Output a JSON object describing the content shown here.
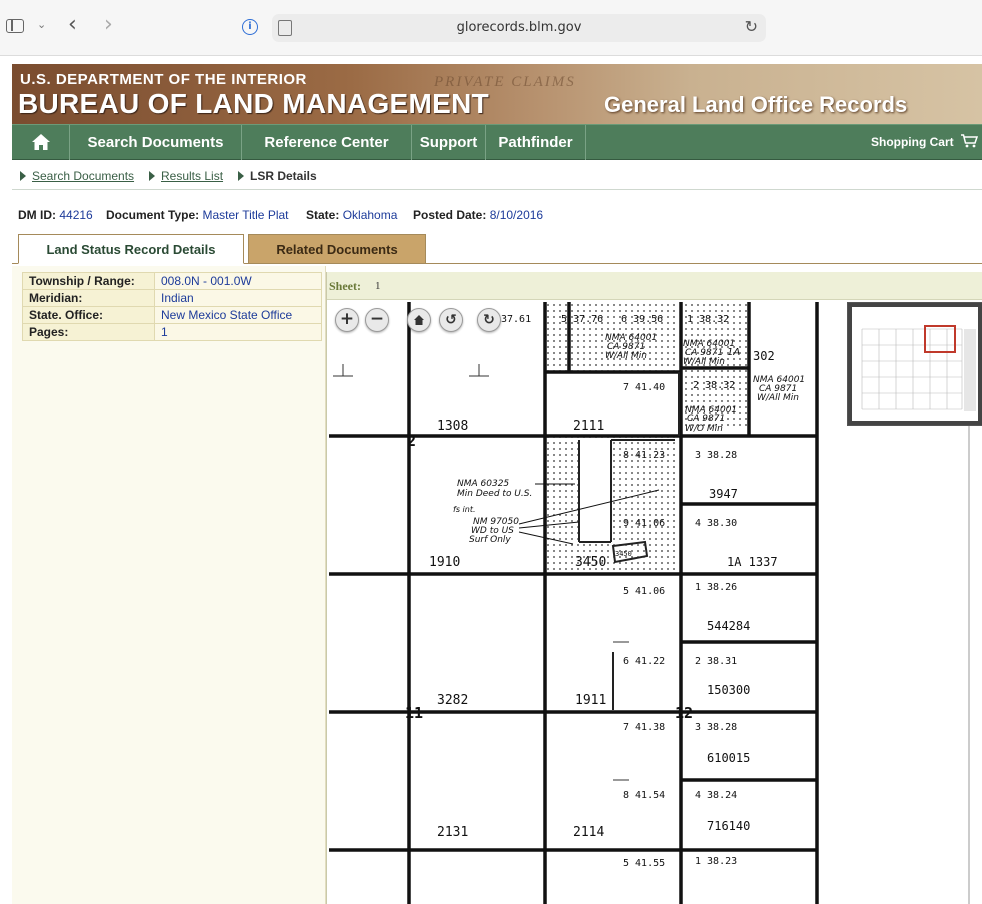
{
  "browser": {
    "url": "glorecords.blm.gov"
  },
  "header": {
    "department": "U.S. DEPARTMENT OF THE INTERIOR",
    "bureau": "BUREAU OF LAND MANAGEMENT",
    "background_text": "PRIVATE CLAIMS",
    "site_title": "General Land Office Records"
  },
  "nav": {
    "items": [
      {
        "label": "Search Documents"
      },
      {
        "label": "Reference Center"
      },
      {
        "label": "Support"
      },
      {
        "label": "Pathfinder"
      }
    ],
    "cart_label": "Shopping Cart"
  },
  "breadcrumb": {
    "items": [
      {
        "label": "Search Documents"
      },
      {
        "label": "Results List"
      }
    ],
    "current": "LSR Details"
  },
  "document": {
    "dm_id_label": "DM ID:",
    "dm_id": "44216",
    "type_label": "Document Type:",
    "type": "Master Title Plat",
    "state_label": "State:",
    "state": "Oklahoma",
    "posted_label": "Posted Date:",
    "posted": "8/10/2016"
  },
  "tabs": [
    {
      "label": "Land Status Record Details",
      "active": true
    },
    {
      "label": "Related Documents",
      "active": false
    }
  ],
  "details": [
    {
      "key": "Township / Range:",
      "value": "008.0N - 001.0W"
    },
    {
      "key": "Meridian:",
      "value": "Indian"
    },
    {
      "key": "State. Office:",
      "value": "New Mexico State Office"
    },
    {
      "key": "Pages:",
      "value": "1"
    }
  ],
  "viewer": {
    "sheet_label": "Sheet:",
    "sheet_number": "1",
    "controls": [
      "zoom-in",
      "zoom-out",
      "home",
      "rotate-left",
      "rotate-right"
    ],
    "plat_labels": {
      "sec1308": "1308",
      "sec2111": "2111",
      "sec1910": "1910",
      "sec3450": "3450",
      "sec3282": "3282",
      "sec1911": "1911",
      "sec2131": "2131",
      "sec2114": "2114",
      "s2": "2",
      "s11": "11",
      "s12": "12",
      "n302": "302",
      "n3947": "3947",
      "n1a1337": "1A 1337",
      "n544284": "544284",
      "n150300": "150300",
      "n610015": "610015",
      "n716140": "716140",
      "n3450b": "3450",
      "lot37_61": "37.61",
      "lot37_76": "5 37.76",
      "lot6_39_56": "6 39.56",
      "lot1_38_32": "1 38.32",
      "lot7_41_40": "7 41.40",
      "lot2_38_32": "2 38.32",
      "lot8_41_23": "8 41.23",
      "lot3_38_28": "3 38.28",
      "lot9_41_06": "9 41.06",
      "lot4_38_30": "4 38.30",
      "lot5_41_06": "5 41.06",
      "lot1_38_26": "1 38.26",
      "lot6_41_22": "6 41.22",
      "lot2_38_31": "2 38.31",
      "lot7_41_38": "7 41.38",
      "lot3_38_28b": "3 38.28",
      "lot8_41_54": "8 41.54",
      "lot4_38_24": "4 38.24",
      "lot5_41_55": "5 41.55",
      "lot1_38_23": "1 38.23",
      "nma64001a": "NMA 64001",
      "ca9871a": "CA 9871",
      "wallmin_a": "W/All Min",
      "nma64001b": "NMA 64001",
      "ca9871b": "CA 9871",
      "wallmin_b": "W/All Min",
      "nma64001c": "NMA 64001",
      "ca9871c": "CA 9871",
      "wallmin_c": "W/All Min",
      "nma64001d": "NMA 64001",
      "ca9871d": "CA 9871",
      "womin": "W/O Min",
      "nma60325": "NMA 60325",
      "mindeed": "Min Deed to U.S.",
      "fsint": "fs int.",
      "nm97050": "NM 97050",
      "wdtous": "WD to US",
      "surfonly": "Surf Only",
      "ia": "1A"
    }
  }
}
